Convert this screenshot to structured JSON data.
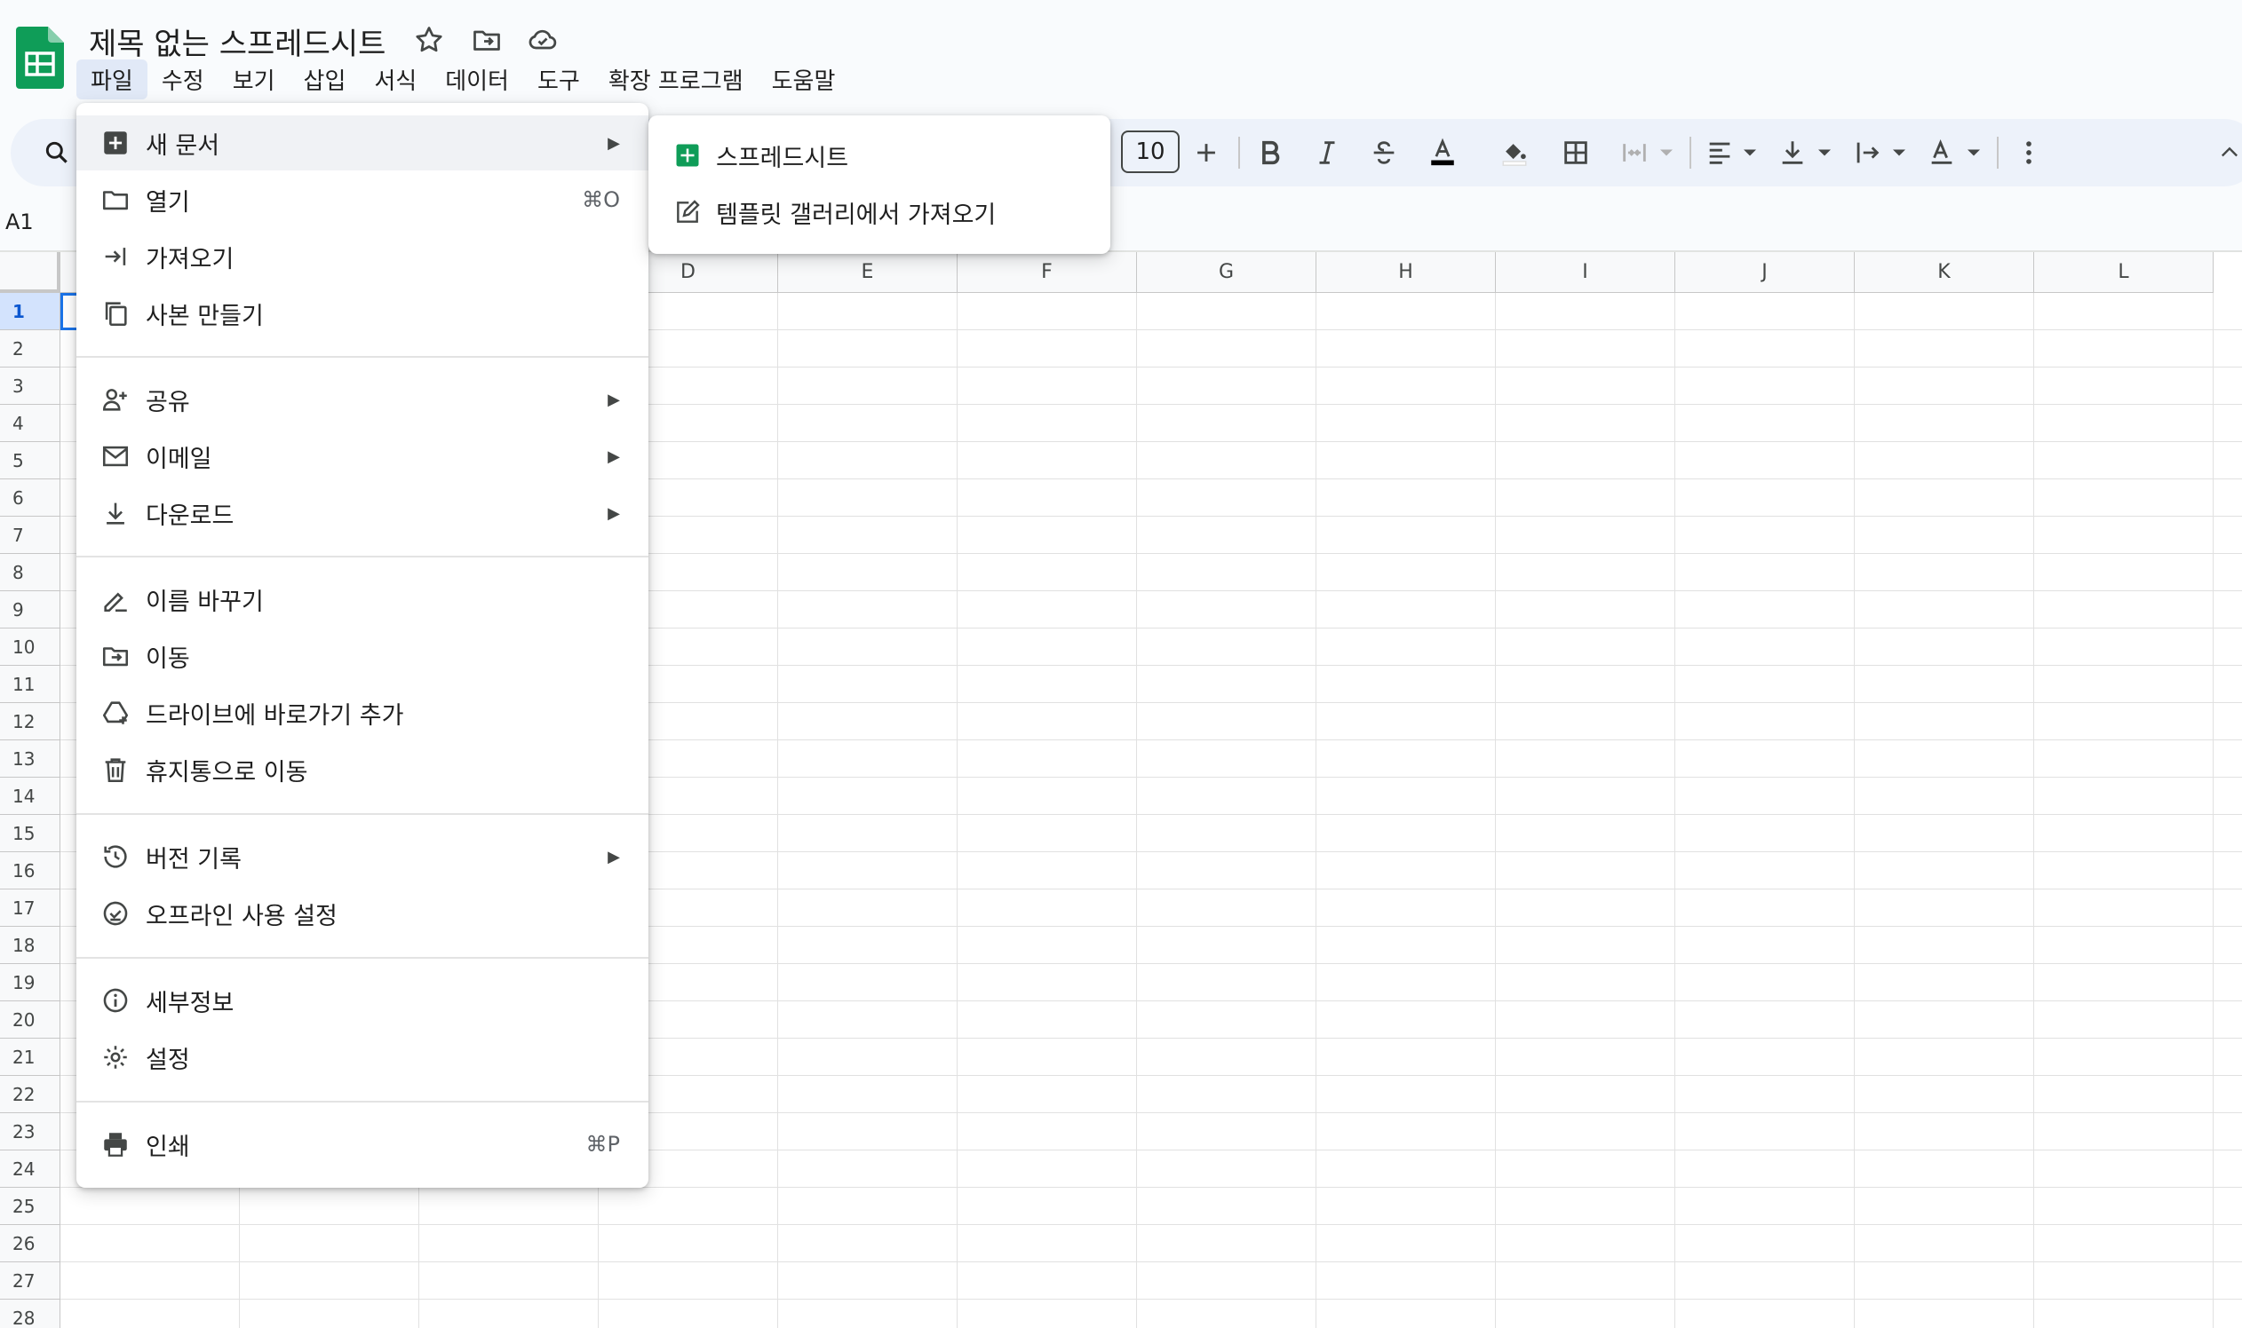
{
  "title": "제목 없는 스프레드시트",
  "menubar": [
    "파일",
    "수정",
    "보기",
    "삽입",
    "서식",
    "데이터",
    "도구",
    "확장 프로그램",
    "도움말"
  ],
  "toolbar": {
    "font_size": "10"
  },
  "name_box": "A1",
  "columns": [
    "D",
    "E",
    "F",
    "G",
    "H",
    "I",
    "J",
    "K",
    "L"
  ],
  "rows": [
    "1",
    "2",
    "3",
    "4",
    "5",
    "6",
    "7",
    "8",
    "9",
    "10",
    "11",
    "12",
    "13",
    "14",
    "15",
    "16",
    "17",
    "18",
    "19",
    "20",
    "21",
    "22",
    "23",
    "24",
    "25",
    "26",
    "27",
    "28"
  ],
  "file_menu": {
    "new": "새 문서",
    "open": "열기",
    "open_shortcut": "⌘O",
    "import": "가져오기",
    "make_copy": "사본 만들기",
    "share": "공유",
    "email": "이메일",
    "download": "다운로드",
    "rename": "이름 바꾸기",
    "move": "이동",
    "add_shortcut": "드라이브에 바로가기 추가",
    "trash": "휴지통으로 이동",
    "version_history": "버전 기록",
    "offline": "오프라인 사용 설정",
    "details": "세부정보",
    "settings": "설정",
    "print": "인쇄",
    "print_shortcut": "⌘P",
    "arrow": "▶"
  },
  "new_submenu": {
    "spreadsheet": "스프레드시트",
    "from_template": "템플릿 갤러리에서 가져오기"
  },
  "colors": {
    "accent": "#1a73e8",
    "sheets_green": "#0f9d58",
    "toolbar_bg": "#edf2fa"
  }
}
